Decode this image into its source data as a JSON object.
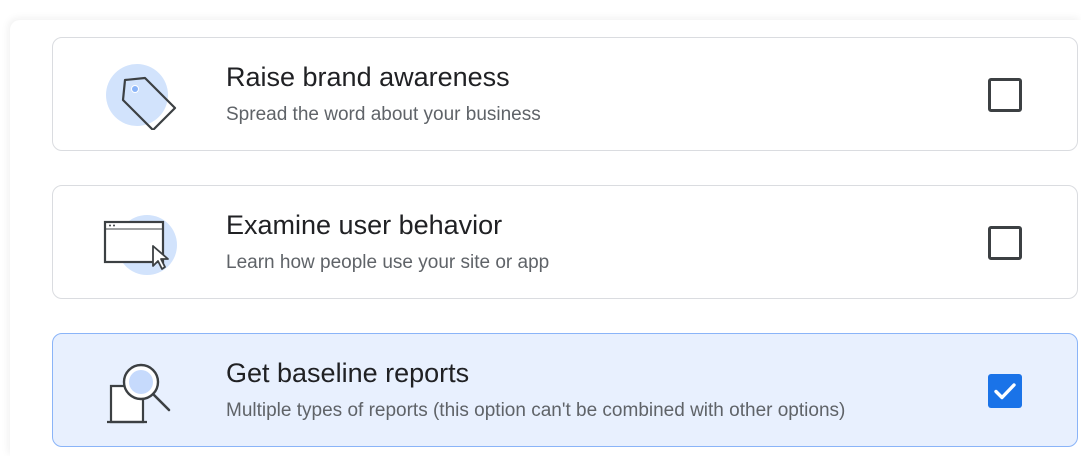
{
  "options": [
    {
      "title": "Raise brand awareness",
      "subtitle": "Spread the word about your business",
      "icon": "tag-icon",
      "checked": false
    },
    {
      "title": "Examine user behavior",
      "subtitle": "Learn how people use your site or app",
      "icon": "browser-cursor-icon",
      "checked": false
    },
    {
      "title": "Get baseline reports",
      "subtitle": "Multiple types of reports (this option can't be combined with other options)",
      "icon": "magnifier-report-icon",
      "checked": true
    }
  ],
  "colors": {
    "accent": "#1a73e8",
    "selected_bg": "#e8f0fe",
    "selected_border": "#8ab4f8",
    "icon_blob": "#d2e3fc",
    "border": "#dadce0"
  }
}
